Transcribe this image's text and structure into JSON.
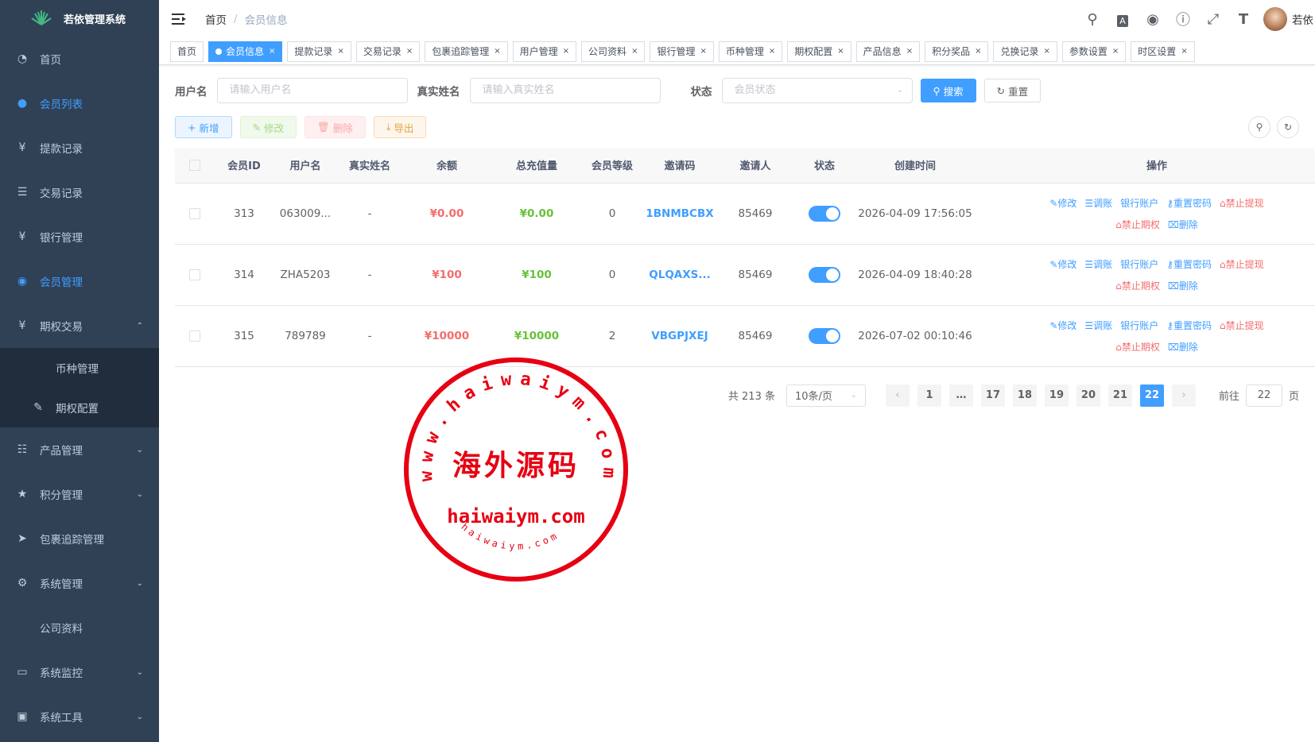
{
  "app": {
    "title": "若依管理系统"
  },
  "sidebar": {
    "items": [
      {
        "label": "首页",
        "icon": "dashboard-icon"
      },
      {
        "label": "会员列表",
        "icon": "user-icon",
        "active": true
      },
      {
        "label": "提款记录",
        "icon": "yen-icon"
      },
      {
        "label": "交易记录",
        "icon": "list-icon"
      },
      {
        "label": "银行管理",
        "icon": "yen-icon"
      },
      {
        "label": "会员管理",
        "icon": "users-icon",
        "active": true
      },
      {
        "label": "期权交易",
        "icon": "yen-icon",
        "expanded": true
      }
    ],
    "submenu": [
      {
        "label": "币种管理"
      },
      {
        "label": "期权配置",
        "icon": "edit-icon"
      }
    ],
    "items2": [
      {
        "label": "产品管理",
        "icon": "cart-icon"
      },
      {
        "label": "积分管理",
        "icon": "star-icon"
      },
      {
        "label": "包裹追踪管理",
        "icon": "send-icon"
      },
      {
        "label": "系统管理",
        "icon": "gear-icon"
      },
      {
        "label": "公司资料"
      },
      {
        "label": "系统监控",
        "icon": "monitor-icon"
      },
      {
        "label": "系统工具",
        "icon": "toolbox-icon"
      }
    ]
  },
  "header": {
    "breadcrumb": [
      "首页",
      "会员信息"
    ],
    "user": "若依"
  },
  "tags": [
    "首页",
    "会员信息",
    "提款记录",
    "交易记录",
    "包裹追踪管理",
    "用户管理",
    "公司资料",
    "银行管理",
    "币种管理",
    "期权配置",
    "产品信息",
    "积分奖品",
    "兑换记录",
    "参数设置",
    "时区设置"
  ],
  "search": {
    "username_label": "用户名",
    "username_placeholder": "请输入用户名",
    "realname_label": "真实姓名",
    "realname_placeholder": "请输入真实姓名",
    "status_label": "状态",
    "status_placeholder": "会员状态",
    "search_btn": "搜索",
    "reset_btn": "重置"
  },
  "toolbar": {
    "add": "新增",
    "edit": "修改",
    "delete": "删除",
    "export": "导出"
  },
  "table": {
    "columns": [
      "会员ID",
      "用户名",
      "真实姓名",
      "余额",
      "总充值量",
      "会员等级",
      "邀请码",
      "邀请人",
      "状态",
      "创建时间",
      "操作"
    ],
    "rows": [
      {
        "id": "313",
        "username": "063009...",
        "realname": "-",
        "balance": "¥0.00",
        "recharge": "¥0.00",
        "level": "0",
        "code": "1BNMBCBX",
        "inviter": "85469",
        "status": true,
        "created": "2026-04-09 17:56:05"
      },
      {
        "id": "314",
        "username": "ZHA5203",
        "realname": "-",
        "balance": "¥100",
        "recharge": "¥100",
        "level": "0",
        "code": "QLQAXS...",
        "inviter": "85469",
        "status": true,
        "created": "2026-04-09 18:40:28"
      },
      {
        "id": "315",
        "username": "789789",
        "realname": "-",
        "balance": "¥10000",
        "recharge": "¥10000",
        "level": "2",
        "code": "VBGPJXEJ",
        "inviter": "85469",
        "status": true,
        "created": "2026-07-02 00:10:46"
      }
    ],
    "actions": [
      "修改",
      "调账",
      "银行账户",
      "重置密码",
      "禁止提现",
      "禁止期权",
      "删除"
    ]
  },
  "pagination": {
    "total": "共 213 条",
    "page_size": "10条/页",
    "pages": [
      "1",
      "…",
      "17",
      "18",
      "19",
      "20",
      "21",
      "22"
    ],
    "current": "22",
    "goto_label": "前往",
    "goto_value": "22",
    "page_unit": "页"
  },
  "watermark": {
    "top_arc": "www.haiwaiym.com",
    "center": "海外源码",
    "domain": "haiwaiym.com",
    "bottom_arc": "haiwaiym.com",
    "color": "#e60012"
  }
}
